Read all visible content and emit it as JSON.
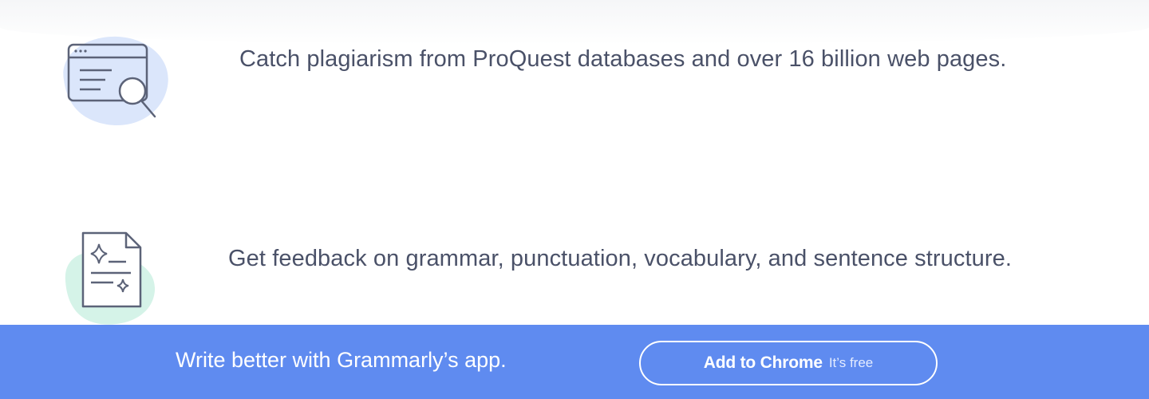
{
  "features": [
    {
      "icon": "browser-search-icon",
      "text": "Catch plagiarism from ProQuest databases and over 16 billion web pages."
    },
    {
      "icon": "document-sparkle-icon",
      "text": "Get feedback on grammar, punctuation, vocabulary, and sentence structure."
    }
  ],
  "banner": {
    "text": "Write better with Grammarly’s app.",
    "button_label": "Add to Chrome",
    "button_sublabel": "It’s free"
  },
  "colors": {
    "banner_background": "#5f8bf0",
    "body_text": "#4a5168",
    "icon_stroke": "#5c6378",
    "blob_blue": "#dbe6fb",
    "blob_green": "#d5f3e8"
  }
}
